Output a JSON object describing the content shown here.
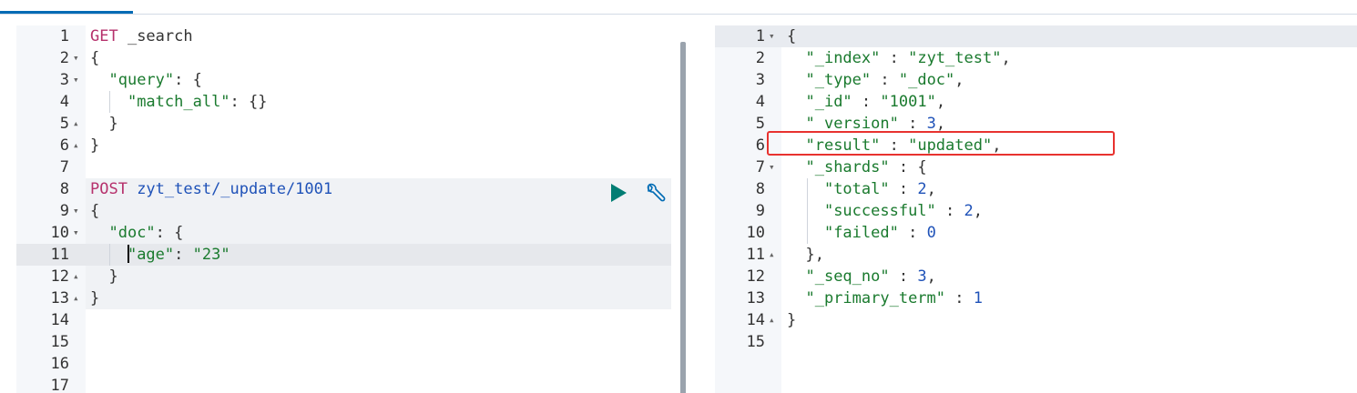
{
  "request_editor": {
    "lines": [
      {
        "n": "1",
        "fold": "",
        "segments": [
          {
            "t": "GET",
            "c": "kw-method"
          },
          {
            "t": " _search",
            "c": "plain"
          }
        ]
      },
      {
        "n": "2",
        "fold": "▾",
        "segments": [
          {
            "t": "{",
            "c": "plain"
          }
        ]
      },
      {
        "n": "3",
        "fold": "▾",
        "segments": [
          {
            "t": "  ",
            "c": "plain"
          },
          {
            "t": "\"query\"",
            "c": "str"
          },
          {
            "t": ": {",
            "c": "plain"
          }
        ]
      },
      {
        "n": "4",
        "fold": "",
        "segments": [
          {
            "t": "    ",
            "c": "plain"
          },
          {
            "t": "\"match_all\"",
            "c": "str"
          },
          {
            "t": ": {}",
            "c": "plain"
          }
        ]
      },
      {
        "n": "5",
        "fold": "▴",
        "segments": [
          {
            "t": "  }",
            "c": "plain"
          }
        ]
      },
      {
        "n": "6",
        "fold": "▴",
        "segments": [
          {
            "t": "}",
            "c": "plain"
          }
        ]
      },
      {
        "n": "7",
        "fold": "",
        "segments": []
      },
      {
        "n": "8",
        "fold": "",
        "segments": [
          {
            "t": "POST",
            "c": "kw-method"
          },
          {
            "t": " zyt_test/_update/1001",
            "c": "url"
          }
        ]
      },
      {
        "n": "9",
        "fold": "▾",
        "segments": [
          {
            "t": "{",
            "c": "plain"
          }
        ]
      },
      {
        "n": "10",
        "fold": "▾",
        "segments": [
          {
            "t": "  ",
            "c": "plain"
          },
          {
            "t": "\"doc\"",
            "c": "str"
          },
          {
            "t": ": {",
            "c": "plain"
          }
        ]
      },
      {
        "n": "11",
        "fold": "",
        "segments": [
          {
            "t": "    ",
            "c": "plain"
          },
          {
            "t": "CURSOR",
            "c": "cursor"
          },
          {
            "t": "\"age\"",
            "c": "str"
          },
          {
            "t": ": ",
            "c": "plain"
          },
          {
            "t": "\"23\"",
            "c": "str"
          }
        ]
      },
      {
        "n": "12",
        "fold": "▴",
        "segments": [
          {
            "t": "  }",
            "c": "plain"
          }
        ]
      },
      {
        "n": "13",
        "fold": "▴",
        "segments": [
          {
            "t": "}",
            "c": "plain"
          }
        ]
      },
      {
        "n": "14",
        "fold": "",
        "segments": []
      },
      {
        "n": "15",
        "fold": "",
        "segments": []
      },
      {
        "n": "16",
        "fold": "",
        "segments": []
      },
      {
        "n": "17",
        "fold": "",
        "segments": []
      }
    ]
  },
  "response_viewer": {
    "lines": [
      {
        "n": "1",
        "fold": "▾",
        "segments": [
          {
            "t": "{",
            "c": "plain"
          }
        ]
      },
      {
        "n": "2",
        "fold": "",
        "segments": [
          {
            "t": "  ",
            "c": "plain"
          },
          {
            "t": "\"_index\"",
            "c": "str"
          },
          {
            "t": " : ",
            "c": "plain"
          },
          {
            "t": "\"zyt_test\"",
            "c": "str"
          },
          {
            "t": ",",
            "c": "plain"
          }
        ]
      },
      {
        "n": "3",
        "fold": "",
        "segments": [
          {
            "t": "  ",
            "c": "plain"
          },
          {
            "t": "\"_type\"",
            "c": "str"
          },
          {
            "t": " : ",
            "c": "plain"
          },
          {
            "t": "\"_doc\"",
            "c": "str"
          },
          {
            "t": ",",
            "c": "plain"
          }
        ]
      },
      {
        "n": "4",
        "fold": "",
        "segments": [
          {
            "t": "  ",
            "c": "plain"
          },
          {
            "t": "\"_id\"",
            "c": "str"
          },
          {
            "t": " : ",
            "c": "plain"
          },
          {
            "t": "\"1001\"",
            "c": "str"
          },
          {
            "t": ",",
            "c": "plain"
          }
        ]
      },
      {
        "n": "5",
        "fold": "",
        "segments": [
          {
            "t": "  ",
            "c": "plain"
          },
          {
            "t": "\"_version\"",
            "c": "str"
          },
          {
            "t": " : ",
            "c": "plain"
          },
          {
            "t": "3",
            "c": "num"
          },
          {
            "t": ",",
            "c": "plain"
          }
        ]
      },
      {
        "n": "6",
        "fold": "",
        "segments": [
          {
            "t": "  ",
            "c": "plain"
          },
          {
            "t": "\"result\"",
            "c": "str"
          },
          {
            "t": " : ",
            "c": "plain"
          },
          {
            "t": "\"updated\"",
            "c": "str"
          },
          {
            "t": ",",
            "c": "plain"
          }
        ]
      },
      {
        "n": "7",
        "fold": "▾",
        "segments": [
          {
            "t": "  ",
            "c": "plain"
          },
          {
            "t": "\"_shards\"",
            "c": "str"
          },
          {
            "t": " : {",
            "c": "plain"
          }
        ]
      },
      {
        "n": "8",
        "fold": "",
        "segments": [
          {
            "t": "    ",
            "c": "plain"
          },
          {
            "t": "\"total\"",
            "c": "str"
          },
          {
            "t": " : ",
            "c": "plain"
          },
          {
            "t": "2",
            "c": "num"
          },
          {
            "t": ",",
            "c": "plain"
          }
        ]
      },
      {
        "n": "9",
        "fold": "",
        "segments": [
          {
            "t": "    ",
            "c": "plain"
          },
          {
            "t": "\"successful\"",
            "c": "str"
          },
          {
            "t": " : ",
            "c": "plain"
          },
          {
            "t": "2",
            "c": "num"
          },
          {
            "t": ",",
            "c": "plain"
          }
        ]
      },
      {
        "n": "10",
        "fold": "",
        "segments": [
          {
            "t": "    ",
            "c": "plain"
          },
          {
            "t": "\"failed\"",
            "c": "str"
          },
          {
            "t": " : ",
            "c": "plain"
          },
          {
            "t": "0",
            "c": "num"
          }
        ]
      },
      {
        "n": "11",
        "fold": "▴",
        "segments": [
          {
            "t": "  },",
            "c": "plain"
          }
        ]
      },
      {
        "n": "12",
        "fold": "",
        "segments": [
          {
            "t": "  ",
            "c": "plain"
          },
          {
            "t": "\"_seq_no\"",
            "c": "str"
          },
          {
            "t": " : ",
            "c": "plain"
          },
          {
            "t": "3",
            "c": "num"
          },
          {
            "t": ",",
            "c": "plain"
          }
        ]
      },
      {
        "n": "13",
        "fold": "",
        "segments": [
          {
            "t": "  ",
            "c": "plain"
          },
          {
            "t": "\"_primary_term\"",
            "c": "str"
          },
          {
            "t": " : ",
            "c": "plain"
          },
          {
            "t": "1",
            "c": "num"
          }
        ]
      },
      {
        "n": "14",
        "fold": "▴",
        "segments": [
          {
            "t": "}",
            "c": "plain"
          }
        ]
      },
      {
        "n": "15",
        "fold": "",
        "segments": []
      }
    ]
  },
  "toolbar": {
    "run_icon": "play-icon",
    "settings_icon": "wrench-icon"
  },
  "colors": {
    "method": "#b6316c",
    "string": "#1a7a2e",
    "number": "#1f52b8",
    "highlight_box": "#e8322f",
    "tab_accent": "#006bb4"
  }
}
